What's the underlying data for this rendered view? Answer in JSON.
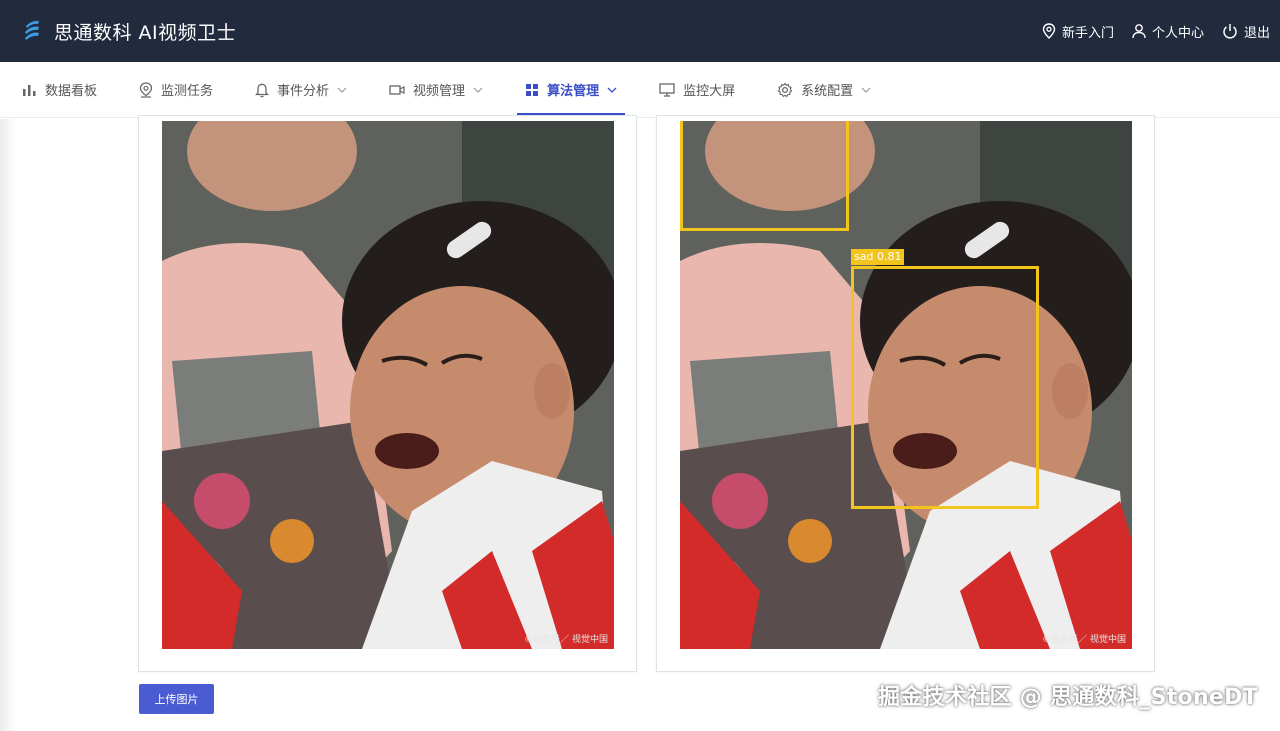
{
  "app": {
    "title": "思通数科 AI视频卫士"
  },
  "header": {
    "guide_label": "新手入门",
    "profile_label": "个人中心",
    "logout_label": "退出"
  },
  "nav": {
    "items": [
      {
        "label": "数据看板",
        "icon": "bar-chart-icon",
        "dropdown": false,
        "active": false
      },
      {
        "label": "监测任务",
        "icon": "location-pin-icon",
        "dropdown": false,
        "active": false
      },
      {
        "label": "事件分析",
        "icon": "bell-icon",
        "dropdown": true,
        "active": false
      },
      {
        "label": "视频管理",
        "icon": "video-camera-icon",
        "dropdown": true,
        "active": false
      },
      {
        "label": "算法管理",
        "icon": "grid-icon",
        "dropdown": true,
        "active": true
      },
      {
        "label": "监控大屏",
        "icon": "monitor-icon",
        "dropdown": false,
        "active": false
      },
      {
        "label": "系统配置",
        "icon": "gear-icon",
        "dropdown": true,
        "active": false
      }
    ]
  },
  "images": {
    "watermark": "©百家号／ 视觉中国",
    "detection": {
      "label": "sad 0.81",
      "color": "#f3c41c"
    }
  },
  "actions": {
    "upload_label": "上传图片"
  },
  "credit": "掘金技术社区 @ 思通数科_StoneDT",
  "colors": {
    "header_bg": "#222a3d",
    "accent": "#3a4fc7",
    "button": "#4b5bd1",
    "box": "#f3c41c"
  }
}
